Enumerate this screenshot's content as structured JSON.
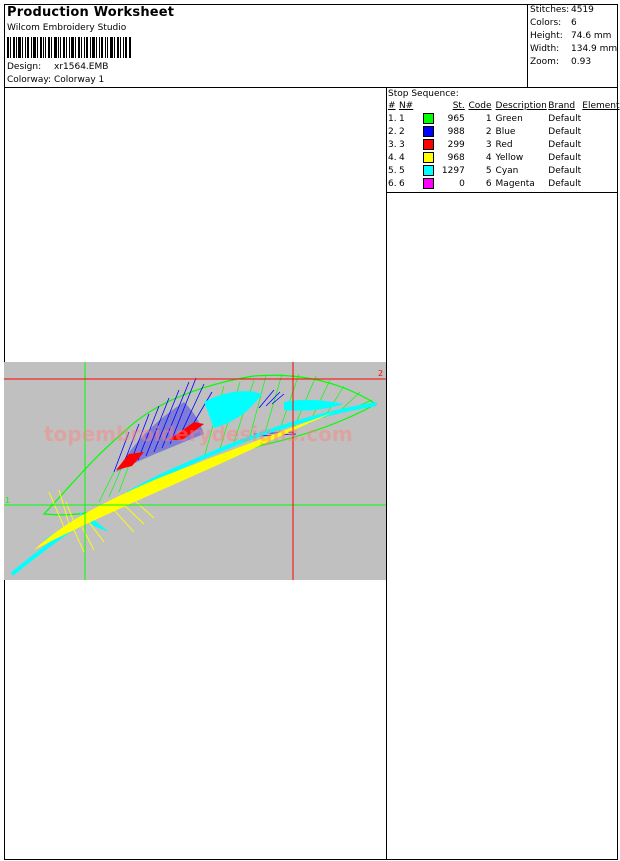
{
  "header": {
    "title": "Production Worksheet",
    "software": "Wilcom Embroidery Studio",
    "design_label": "Design:",
    "design_value": "xr1564.EMB",
    "colorway_label": "Colorway:",
    "colorway_value": "Colorway 1"
  },
  "stats": [
    {
      "label": "Stitches:",
      "value": "4519"
    },
    {
      "label": "Colors:",
      "value": "6"
    },
    {
      "label": "Height:",
      "value": "74.6 mm"
    },
    {
      "label": "Width:",
      "value": "134.9 mm"
    },
    {
      "label": "Zoom:",
      "value": "0.93"
    }
  ],
  "stop_sequence": {
    "title": "Stop Sequence:",
    "headers": [
      "#",
      "N#",
      "St.",
      "Code",
      "Description",
      "Brand",
      "Element"
    ],
    "rows": [
      {
        "num": "1.",
        "n": "1",
        "color": "#00ff00",
        "st": "965",
        "code": "1",
        "description": "Green",
        "brand": "Default"
      },
      {
        "num": "2.",
        "n": "2",
        "color": "#0000ff",
        "st": "988",
        "code": "2",
        "description": "Blue",
        "brand": "Default"
      },
      {
        "num": "3.",
        "n": "3",
        "color": "#ff0000",
        "st": "299",
        "code": "3",
        "description": "Red",
        "brand": "Default"
      },
      {
        "num": "4.",
        "n": "4",
        "color": "#ffff00",
        "st": "968",
        "code": "4",
        "description": "Yellow",
        "brand": "Default"
      },
      {
        "num": "5.",
        "n": "5",
        "color": "#00ffff",
        "st": "1297",
        "code": "5",
        "description": "Cyan",
        "brand": "Default"
      },
      {
        "num": "6.",
        "n": "6",
        "color": "#ff00ff",
        "st": "0",
        "code": "6",
        "description": "Magenta",
        "brand": "Default"
      }
    ]
  },
  "design_view": {
    "background": "#c0c0c0",
    "guide_color": "#ff0000",
    "marker_top_right": "2",
    "marker_left": "1",
    "watermark": "topembroiderydesigns.com",
    "colors": {
      "green": "#00ff00",
      "blue": "#0000ff",
      "red": "#ff0000",
      "yellow": "#ffff00",
      "cyan": "#00ffff",
      "magenta": "#ff00ff"
    }
  }
}
